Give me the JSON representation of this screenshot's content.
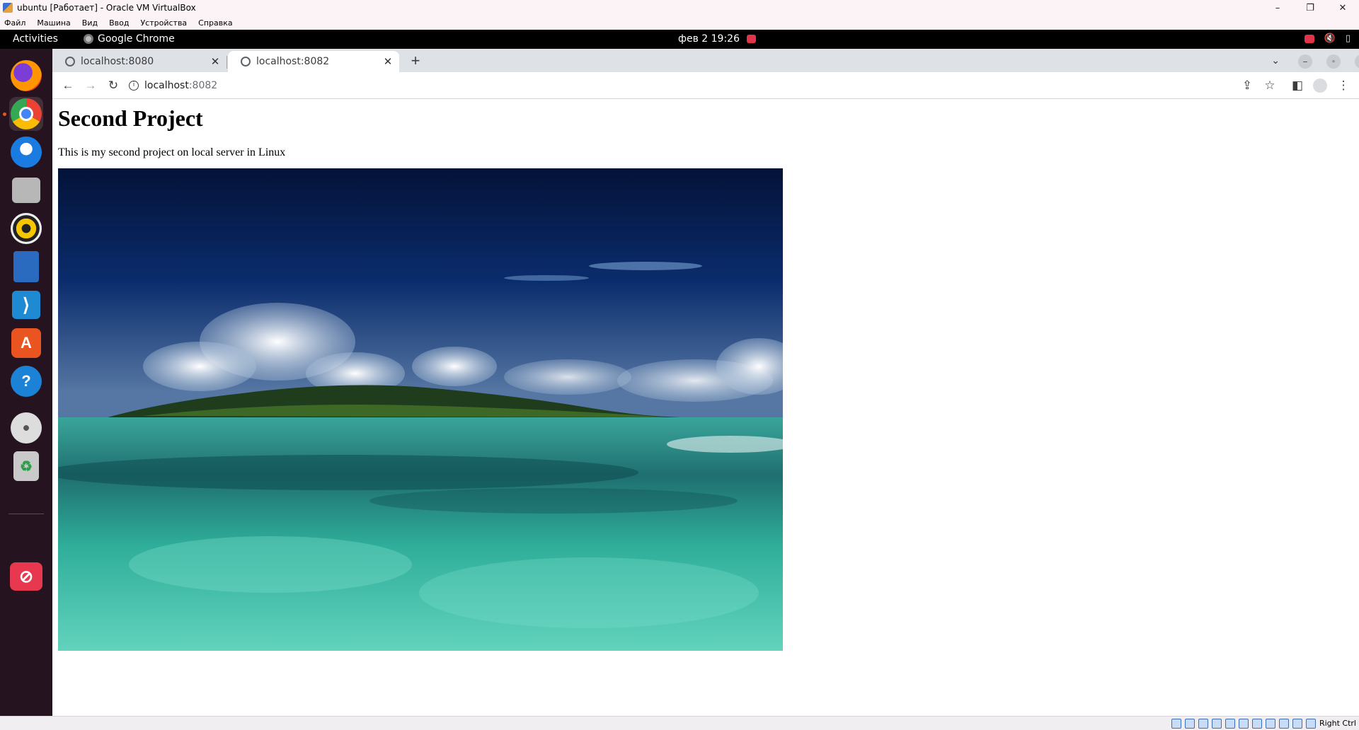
{
  "vbox": {
    "title": "ubuntu [Работает] - Oracle VM VirtualBox",
    "menu": [
      "Файл",
      "Машина",
      "Вид",
      "Ввод",
      "Устройства",
      "Справка"
    ],
    "window_controls": {
      "minimize": "–",
      "restore": "❐",
      "close": "✕"
    },
    "host_key": "Right Ctrl"
  },
  "ubuntu": {
    "activities": "Activities",
    "app_name": "Google Chrome",
    "clock": "фев 2  19:26"
  },
  "chrome": {
    "tabs": [
      {
        "label": "localhost:8080",
        "close": "✕"
      },
      {
        "label": "localhost:8082",
        "close": "✕"
      }
    ],
    "new_tab": "+",
    "tab_search": "⌄",
    "nav": {
      "back": "←",
      "forward": "→",
      "reload": "↻"
    },
    "url_host": "localhost",
    "url_port": ":8082",
    "toolbar_icons": {
      "share": "⇪",
      "star": "☆",
      "side_panel": "◧",
      "menu": "⋮"
    }
  },
  "page": {
    "heading": "Second Project",
    "paragraph": "This is my second project on local server in Linux"
  }
}
